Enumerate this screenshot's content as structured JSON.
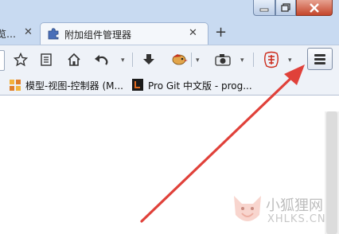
{
  "tabs": [
    {
      "label": "览…",
      "close": "✕"
    },
    {
      "label": "附加组件管理器",
      "close": "✕"
    }
  ],
  "new_tab": "+",
  "toolbar": {
    "dropdown": "▾",
    "menu_tooltip": ""
  },
  "bookmarks": [
    {
      "label": "模型-视图-控制器 (M..."
    },
    {
      "label": "Pro Git 中文版 - prog..."
    }
  ],
  "watermark": {
    "text": "小狐狸网",
    "sub": "XHLKS.CN"
  },
  "colors": {
    "arrow": "#e0413a",
    "titlebar": "#c8daf1",
    "toolbar": "#eef2f8"
  }
}
